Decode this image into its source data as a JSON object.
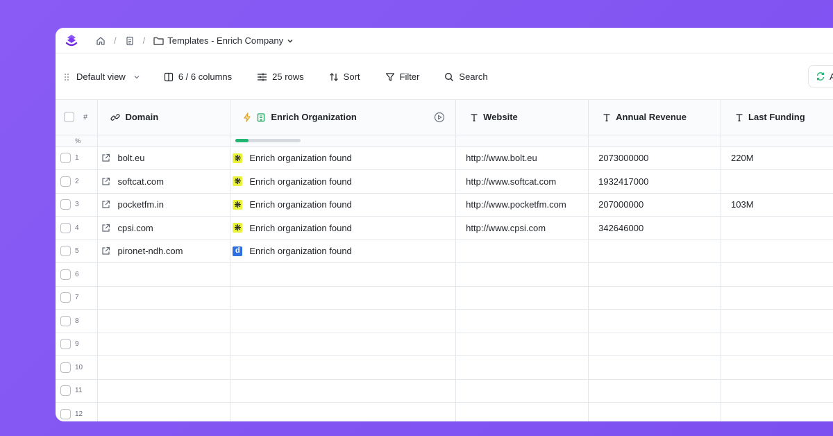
{
  "breadcrumb": {
    "folder_label": "Templates - Enrich Company"
  },
  "toolbar": {
    "view_label": "Default view",
    "columns_label": "6 / 6 columns",
    "rows_label": "25 rows",
    "sort_label": "Sort",
    "filter_label": "Filter",
    "search_label": "Search",
    "right_button_label": "A"
  },
  "columns": {
    "rownum": "#",
    "domain": "Domain",
    "enrich": "Enrich Organization",
    "website": "Website",
    "revenue": "Annual Revenue",
    "funding": "Last Funding"
  },
  "progress": {
    "label": "%",
    "fraction": 0.2
  },
  "rows": [
    {
      "num": "1",
      "domain": "bolt.eu",
      "enrich": "Enrich organization found",
      "badge": "y",
      "website": "http://www.bolt.eu",
      "revenue": "2073000000",
      "funding": "220M"
    },
    {
      "num": "2",
      "domain": "softcat.com",
      "enrich": "Enrich organization found",
      "badge": "y",
      "website": "http://www.softcat.com",
      "revenue": "1932417000",
      "funding": ""
    },
    {
      "num": "3",
      "domain": "pocketfm.in",
      "enrich": "Enrich organization found",
      "badge": "y",
      "website": "http://www.pocketfm.com",
      "revenue": "207000000",
      "funding": "103M"
    },
    {
      "num": "4",
      "domain": "cpsi.com",
      "enrich": "Enrich organization found",
      "badge": "y",
      "website": "http://www.cpsi.com",
      "revenue": "342646000",
      "funding": ""
    },
    {
      "num": "5",
      "domain": "pironet-ndh.com",
      "enrich": "Enrich organization found",
      "badge": "d",
      "website": "",
      "revenue": "",
      "funding": ""
    },
    {
      "num": "6"
    },
    {
      "num": "7"
    },
    {
      "num": "8"
    },
    {
      "num": "9"
    },
    {
      "num": "10"
    },
    {
      "num": "11"
    },
    {
      "num": "12"
    }
  ],
  "badge_glyphs": {
    "y": "❋",
    "d": "d"
  },
  "colors": {
    "background": "#8b5cf6",
    "progress_fill": "#22b573",
    "logo": "#7c3aed",
    "refresh_icon": "#22b573"
  }
}
